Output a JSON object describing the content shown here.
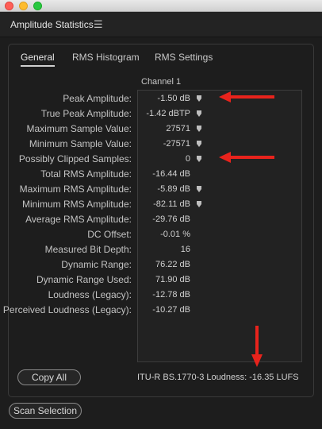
{
  "window": {
    "controls": [
      "close",
      "minimize",
      "zoom"
    ]
  },
  "panel": {
    "title": "Amplitude Statistics",
    "menu_icon": "hamburger-menu-icon"
  },
  "tabs": [
    {
      "label": "General",
      "active": true
    },
    {
      "label": "RMS Histogram",
      "active": false
    },
    {
      "label": "RMS Settings",
      "active": false
    }
  ],
  "table": {
    "column_header": "Channel 1",
    "rows": [
      {
        "label": "Peak Amplitude:",
        "value": "-1.50 dB",
        "marker": true
      },
      {
        "label": "True Peak Amplitude:",
        "value": "-1.42 dBTP",
        "marker": true
      },
      {
        "label": "Maximum Sample Value:",
        "value": "27571",
        "marker": true
      },
      {
        "label": "Minimum Sample Value:",
        "value": "-27571",
        "marker": true
      },
      {
        "label": "Possibly Clipped Samples:",
        "value": "0",
        "marker": true
      },
      {
        "label": "Total RMS Amplitude:",
        "value": "-16.44 dB",
        "marker": false
      },
      {
        "label": "Maximum RMS Amplitude:",
        "value": "-5.89 dB",
        "marker": true
      },
      {
        "label": "Minimum RMS Amplitude:",
        "value": "-82.11 dB",
        "marker": true
      },
      {
        "label": "Average RMS Amplitude:",
        "value": "-29.76 dB",
        "marker": false
      },
      {
        "label": "DC Offset:",
        "value": "-0.01 %",
        "marker": false
      },
      {
        "label": "Measured Bit Depth:",
        "value": "16",
        "marker": false
      },
      {
        "label": "Dynamic Range:",
        "value": "76.22 dB",
        "marker": false
      },
      {
        "label": "Dynamic Range Used:",
        "value": "71.90 dB",
        "marker": false
      },
      {
        "label": "Loudness (Legacy):",
        "value": "-12.78 dB",
        "marker": false
      },
      {
        "label": "Perceived Loudness (Legacy):",
        "value": "-10.27 dB",
        "marker": false
      }
    ]
  },
  "loudness_readout": "ITU-R BS.1770-3 Loudness:  -16.35 LUFS",
  "buttons": {
    "copy_all": "Copy All",
    "scan_selection": "Scan Selection"
  },
  "colors": {
    "background": "#1d1d1d",
    "annotation_arrow": "#e8231c"
  }
}
